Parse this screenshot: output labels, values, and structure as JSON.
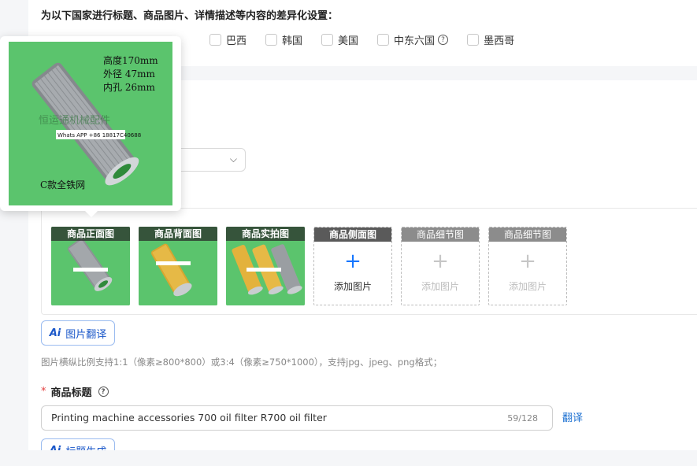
{
  "country_section": {
    "title": "为以下国家进行标题、商品图片、详情描述等内容的差异化设置：",
    "countries": [
      {
        "label": "巴西"
      },
      {
        "label": "韩国"
      },
      {
        "label": "美国"
      },
      {
        "label": "中东六国"
      },
      {
        "label": "墨西哥"
      }
    ]
  },
  "popover": {
    "spec_lines": [
      "高度170mm",
      "外径 47mm",
      "内孔 26mm"
    ],
    "watermark": "恒运通机械配件",
    "contact": "Whats APP +86 18817C40688",
    "caption": "C款全铁网"
  },
  "image_slots": [
    {
      "label": "商品正面图",
      "state": "filled"
    },
    {
      "label": "商品背面图",
      "state": "filled"
    },
    {
      "label": "商品实拍图",
      "state": "filled"
    },
    {
      "label": "商品侧面图",
      "state": "empty",
      "add_text": "添加图片"
    },
    {
      "label": "商品细节图",
      "state": "disabled",
      "add_text": "添加图片"
    },
    {
      "label": "商品细节图",
      "state": "disabled",
      "add_text": "添加图片"
    }
  ],
  "image_translate_button": "图片翻译",
  "image_hint": "图片横纵比例支持1:1（像素≥800*800）或3:4（像素≥750*1000），支持jpg、jpeg、png格式；",
  "title_field": {
    "label": "商品标题",
    "value": "Printing machine accessories 700 oil filter R700 oil filter",
    "count": "59/128",
    "translate_link": "翻译"
  },
  "title_generate_button": "标题生成",
  "colors": {
    "accent": "#1677ff",
    "required": "#e34040",
    "thumb_bg": "#57c26a"
  }
}
